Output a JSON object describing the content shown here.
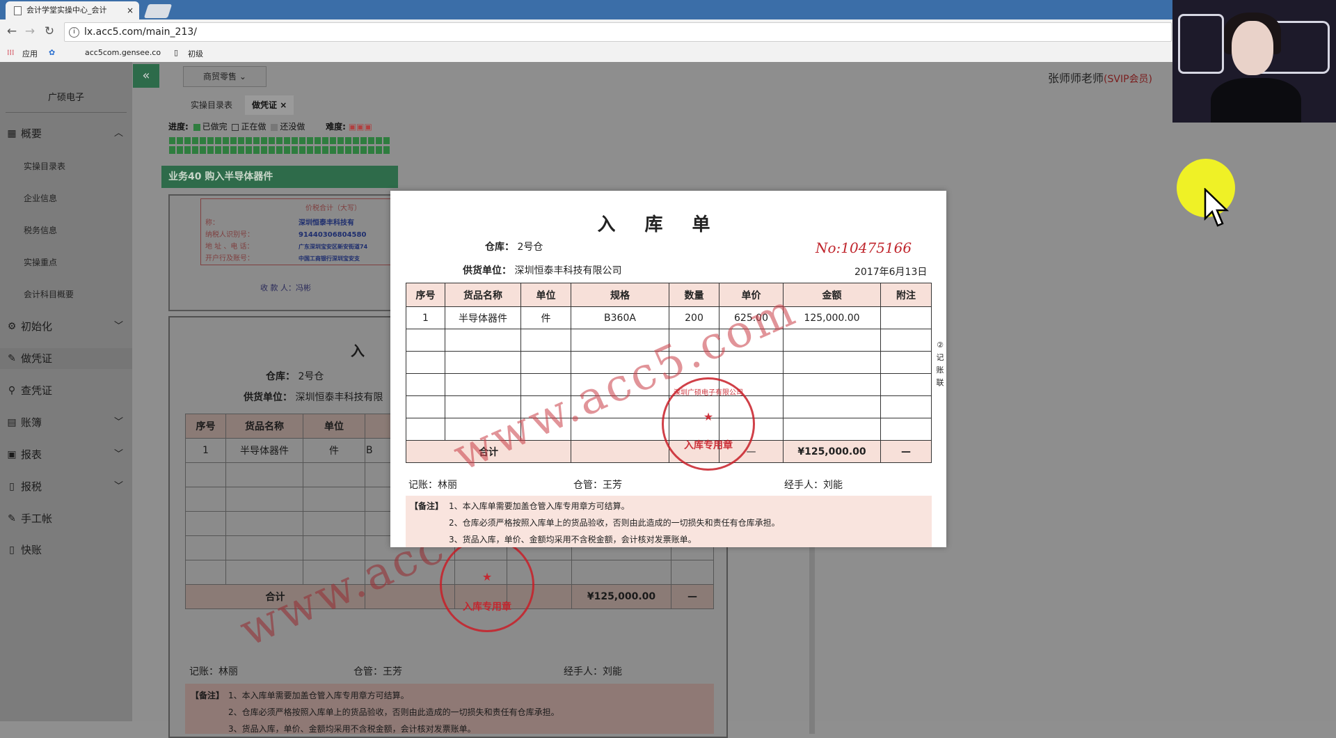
{
  "browser": {
    "tab_title": "会计学堂实操中心_会计",
    "tab_close": "×",
    "url": "lx.acc5.com/main_213/",
    "bookmarks": [
      "应用",
      "acc5com.gensee.co",
      "初级"
    ]
  },
  "header": {
    "collapse_icon": "«",
    "menu_dropdown": "商贸零售",
    "user": "张师师老师",
    "vip": "(SVIP会员)"
  },
  "sidebar": {
    "company": "广硕电子",
    "items": [
      {
        "label": "概要",
        "icon": "grid-icon"
      },
      {
        "label": "初始化",
        "icon": "gear-icon"
      },
      {
        "label": "做凭证",
        "icon": "pen-icon"
      },
      {
        "label": "查凭证",
        "icon": "search-icon"
      },
      {
        "label": "账簿",
        "icon": "book-icon"
      },
      {
        "label": "报表",
        "icon": "report-icon"
      },
      {
        "label": "报税",
        "icon": "doc-icon"
      },
      {
        "label": "手工帐",
        "icon": "pen-icon"
      },
      {
        "label": "快账",
        "icon": "doc-icon"
      }
    ],
    "sub_items": [
      "实操目录表",
      "企业信息",
      "税务信息",
      "实操重点",
      "会计科目概要"
    ]
  },
  "page_tabs": {
    "tab1": "实操目录表",
    "tab2": "做凭证",
    "tab2_close": "×"
  },
  "progress": {
    "label": "进度:",
    "done": "已做完",
    "doing": "正在做",
    "todo": "还没做",
    "difficulty": "难度:"
  },
  "task": {
    "title": "业务40 购入半导体器件"
  },
  "bg_invoice": {
    "fields": [
      "称：",
      "纳税人识别号：",
      "地 址 、电 话：",
      "开户行及账号："
    ],
    "values": [
      "深圳恒泰丰科技有",
      "91440306804580",
      "广东深圳宝安区新安街道74",
      "中国工商银行深圳宝安支"
    ],
    "payee": "收 款 人：冯彬"
  },
  "receipt": {
    "title": "入库单",
    "warehouse_label": "仓库：",
    "warehouse": "2号仓",
    "number": "No:10475166",
    "supplier_label": "供货单位：",
    "supplier": "深圳恒泰丰科技有限公司",
    "date": "2017年6月13日",
    "columns": [
      "序号",
      "货品名称",
      "单位",
      "规格",
      "数量",
      "单价",
      "金额",
      "附注"
    ],
    "rows": [
      [
        "1",
        "半导体器件",
        "件",
        "B360A",
        "200",
        "625.00",
        "125,000.00",
        ""
      ]
    ],
    "total_label": "合计",
    "total_dash": "—",
    "total_amount": "¥125,000.00",
    "total_note": "—",
    "bookkeeper": "记账：林丽",
    "keeper": "仓管：王芳",
    "handler": "经手人：刘能",
    "notes_tag": "【备注】",
    "notes": [
      "1、本入库单需要加盖仓管入库专用章方可结算。",
      "2、仓库必须严格按照入库单上的货品验收，否则由此造成的一切损失和责任有仓库承担。",
      "3、货品入库，单价、金额均采用不含税金额，会计核对发票账单。"
    ],
    "side_label": "②记账联",
    "watermark": "www.acc5.com",
    "stamp_text": "入库专用章",
    "stamp_ring": "深圳广硕电子有限公司"
  },
  "bg_receipt": {
    "title": "入",
    "warehouse_label": "仓库：",
    "warehouse": "2号仓",
    "supplier_label": "供货单位：",
    "supplier": "深圳恒泰丰科技有限",
    "columns": [
      "序号",
      "货品名称",
      "单位"
    ],
    "row": [
      "1",
      "半导体器件",
      "件",
      "B"
    ],
    "total_label": "合计",
    "total_amount": "¥125,000.00",
    "total_note": "—",
    "bookkeeper": "记账：林丽",
    "keeper": "仓管：王芳",
    "handler": "经手人：刘能",
    "side_label": "账联",
    "watermark": "www.acc"
  }
}
